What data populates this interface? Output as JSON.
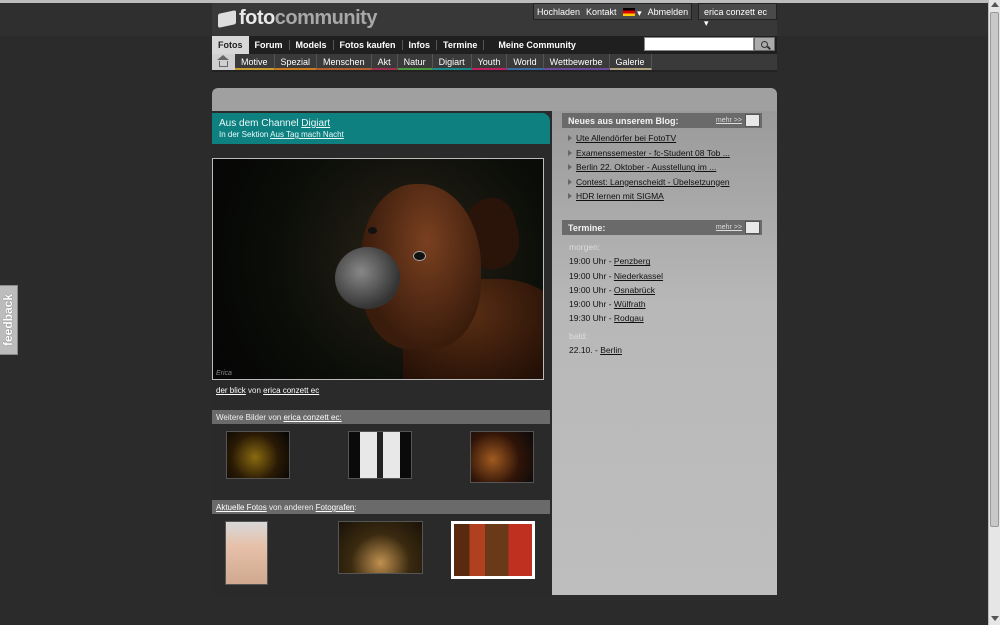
{
  "header": {
    "logo_part1": "foto",
    "logo_part2": "community",
    "topnav": [
      "Hochladen",
      "Kontakt",
      "Abmelden"
    ],
    "user": "erica conzett ec"
  },
  "mainnav": {
    "tabs": [
      "Fotos",
      "Forum",
      "Models",
      "Fotos kaufen",
      "Infos",
      "Termine"
    ],
    "community": "Meine Community",
    "search_value": ""
  },
  "subnav": {
    "categories": [
      {
        "label": "Motive",
        "color": "#c89a30"
      },
      {
        "label": "Spezial",
        "color": "#c87a20"
      },
      {
        "label": "Menschen",
        "color": "#b06030"
      },
      {
        "label": "Akt",
        "color": "#a03050"
      },
      {
        "label": "Natur",
        "color": "#4a9a40"
      },
      {
        "label": "Digiart",
        "color": "#1a8a8a"
      },
      {
        "label": "Youth",
        "color": "#c02060"
      },
      {
        "label": "World",
        "color": "#3a6aa0"
      },
      {
        "label": "Wettbewerbe",
        "color": "#6a4a9a"
      },
      {
        "label": "Galerie",
        "color": "#b0a080"
      }
    ]
  },
  "channel": {
    "prefix": "Aus dem Channel",
    "channel": "Digiart",
    "section_prefix": "In der Sektion",
    "section": "Aus Tag mach Nacht"
  },
  "photo": {
    "title": "der blick",
    "by": "von",
    "author": "erica conzett ec",
    "signature": "Erica"
  },
  "more_by": {
    "prefix": "Weitere Bilder von",
    "author": "erica conzett ec:"
  },
  "recent": {
    "link1": "Aktuelle Fotos",
    "middle": "von anderen",
    "link2": "Fotografen",
    "suffix": ":"
  },
  "blog": {
    "title": "Neues aus unserem Blog:",
    "more": "mehr >>",
    "items": [
      "Ute Allendörfer bei FotoTV",
      "Examenssemester - fc-Student 08 Tob ...",
      "Berlin 22. Oktober - Ausstellung im ...",
      "Contest: Langenscheidt - Übelsetzungen",
      "HDR lernen mit SIGMA"
    ]
  },
  "termine": {
    "title": "Termine:",
    "more": "mehr >>",
    "tomorrow_label": "morgen:",
    "tomorrow": [
      {
        "time": "19:00 Uhr -",
        "place": "Penzberg"
      },
      {
        "time": "19:00 Uhr -",
        "place": "Niederkassel"
      },
      {
        "time": "19:00 Uhr -",
        "place": "Osnabrück"
      },
      {
        "time": "19:00 Uhr -",
        "place": "Wülfrath"
      },
      {
        "time": "19:30 Uhr -",
        "place": "Rodgau"
      }
    ],
    "soon_label": "bald:",
    "soon": [
      {
        "time": "22.10. -",
        "place": "Berlin"
      }
    ]
  },
  "feedback": "feedback"
}
